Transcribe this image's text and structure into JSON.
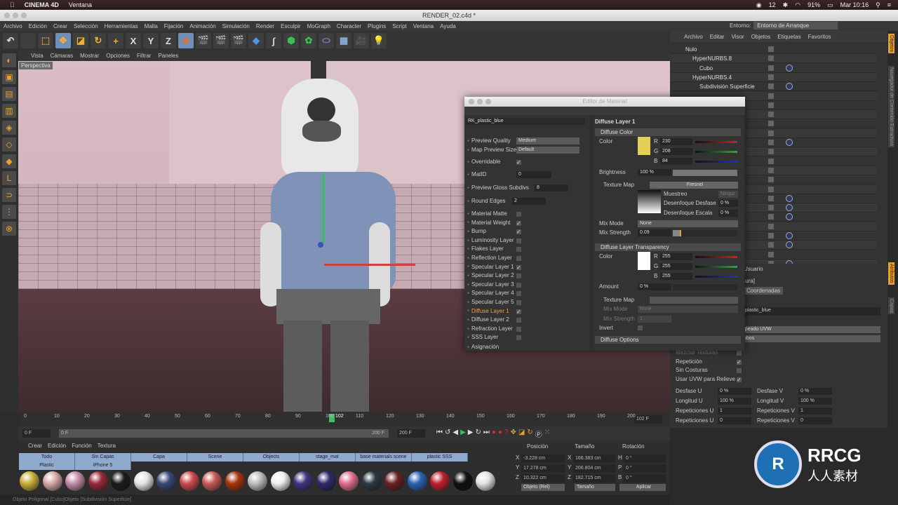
{
  "macbar": {
    "app": "CINEMA 4D",
    "menu": "Ventana",
    "status": [
      "12",
      "91%"
    ],
    "clock": "Mar 10:16"
  },
  "window": {
    "title": "RENDER_02.c4d *"
  },
  "mainmenu": [
    "Archivo",
    "Edición",
    "Crear",
    "Selección",
    "Herramientas",
    "Malla",
    "Fijación",
    "Animación",
    "Simulación",
    "Render",
    "Esculpir",
    "MoGraph",
    "Character",
    "Plugins",
    "Script",
    "Ventana",
    "Ayuda"
  ],
  "env": {
    "label": "Entorno:",
    "value": "Entorno de Arranque"
  },
  "toolbar": {
    "axes": [
      "X",
      "Y",
      "Z"
    ]
  },
  "viewport": {
    "menu": [
      "Vista",
      "Cámaras",
      "Mostrar",
      "Opciones",
      "Filtrar",
      "Paneles"
    ],
    "label": "Perspectiva"
  },
  "timeline": {
    "ticks": [
      "0",
      "10",
      "20",
      "30",
      "40",
      "50",
      "60",
      "70",
      "80",
      "90",
      "100",
      "110",
      "120",
      "130",
      "140",
      "150",
      "160",
      "170",
      "180",
      "190",
      "200"
    ],
    "current": "102",
    "current_field": "102 F",
    "start": "0 F",
    "range_start": "0 F",
    "range_end": "200 F",
    "end": "200 F"
  },
  "materials": {
    "menu": [
      "Crear",
      "Edición",
      "Función",
      "Textura"
    ],
    "layers": [
      "Todo",
      "Sin Capas",
      "Capa",
      "Scene",
      "Objects",
      "stage_mat",
      "base materials scene",
      "plastic SSS",
      "Plastic",
      "iPhone 5"
    ],
    "swatches": [
      "#c9b03a",
      "#d4aaa4",
      "#c48ca8",
      "#9a2a3a",
      "#1c1c20",
      "#e6e6e6",
      "#3a4a78",
      "#d04a50",
      "#c85a58",
      "#a8340e",
      "#bdbdbd",
      "#efefef",
      "#3e3680",
      "#2e2a6a",
      "#e0708e",
      "#2a3a44",
      "#6a2224",
      "#2a64b4",
      "#c0202c",
      "#101010",
      "#e4e4e4"
    ]
  },
  "coords": {
    "headers": [
      "Posición",
      "Tamaño",
      "Rotación"
    ],
    "rows": [
      {
        "axis": "X",
        "pos": "-3.228 cm",
        "size": "166.383 cm",
        "rl": "H",
        "rot": "0 °"
      },
      {
        "axis": "Y",
        "pos": "17.278 cm",
        "size": "206.804 cm",
        "rl": "P",
        "rot": "0 °"
      },
      {
        "axis": "Z",
        "pos": "10.322 cm",
        "size": "182.715 cm",
        "rl": "B",
        "rot": "0 °"
      }
    ],
    "mode": "Objeto (Rel)",
    "size_mode": "Tamaño",
    "apply": "Aplicar"
  },
  "status": "Objeto Poligonal [Cubo]Objeto [Subdivisión Superficie]",
  "objmgr": {
    "menu": [
      "Archivo",
      "Editar",
      "Visor",
      "Objetos",
      "Etiquetas",
      "Favoritos"
    ],
    "objects": [
      {
        "name": "Nulo",
        "indent": 0
      },
      {
        "name": "HyperNURBS.8",
        "indent": 1
      },
      {
        "name": "Cubo",
        "indent": 2
      },
      {
        "name": "HyperNURBS.4",
        "indent": 1
      },
      {
        "name": "Subdivisión Superficie",
        "indent": 2
      }
    ]
  },
  "sidetabs": [
    "Objetos",
    "Navegador de Contenido",
    "Estructura",
    "Atributos",
    "Capas"
  ],
  "attr": {
    "mode": "Usuario",
    "tab_partial": "tura]",
    "coord_tab": "Coordenadas",
    "material": "_plastic_blue",
    "projection": "apeado UVW",
    "side": "mbos",
    "checks": [
      {
        "label": "Mezclar Texturas",
        "checked": false
      },
      {
        "label": "Repetición",
        "checked": true
      },
      {
        "label": "Sin Costuras",
        "checked": false
      },
      {
        "label": "Usar UVW para Relieve",
        "checked": true
      }
    ],
    "fields": [
      {
        "l1": "Desfase U",
        "v1": "0 %",
        "l2": "Desfase V",
        "v2": "0 %"
      },
      {
        "l1": "Longitud U",
        "v1": "100 %",
        "l2": "Longitud V",
        "v2": "100 %"
      },
      {
        "l1": "Repeticiones U",
        "v1": "1",
        "l2": "Repeticiones V",
        "v2": "1"
      },
      {
        "l1": "Repeticiones U",
        "v1": "0",
        "l2": "Repeticiones V",
        "v2": "0"
      }
    ]
  },
  "mated": {
    "title": "Editor de Material",
    "name": "RK_plastic_blue",
    "preview_quality": {
      "label": "Preview Quality",
      "value": "Medium"
    },
    "map_preview": {
      "label": "Map Preview Size",
      "value": "Default"
    },
    "overridable": "Overridable",
    "matid": {
      "label": "MatID",
      "value": "0"
    },
    "gloss": {
      "label": "Preview Gloss Subdivs",
      "value": "8"
    },
    "round": {
      "label": "Round Edges",
      "value": "2"
    },
    "layers": [
      {
        "label": "Material Matte",
        "checked": false
      },
      {
        "label": "Material Weight",
        "checked": true
      },
      {
        "label": "Bump",
        "checked": true
      },
      {
        "label": "Luminosity Layer",
        "checked": false
      },
      {
        "label": "Flakes Layer",
        "checked": false
      },
      {
        "label": "Reflection Layer",
        "checked": false
      },
      {
        "label": "Specular Layer 1",
        "checked": true
      },
      {
        "label": "Specular Layer 2",
        "checked": false
      },
      {
        "label": "Specular Layer 3",
        "checked": false
      },
      {
        "label": "Specular Layer 4",
        "checked": false
      },
      {
        "label": "Specular Layer 5",
        "checked": false
      },
      {
        "label": "Diffuse Layer 1",
        "checked": true,
        "active": true
      },
      {
        "label": "Diffuse Layer 2",
        "checked": false
      },
      {
        "label": "Refraction Layer",
        "checked": false
      },
      {
        "label": "SSS Layer",
        "checked": false
      }
    ],
    "assign": "Asignación",
    "right": {
      "title": "Diffuse Layer 1",
      "diffuse_color": "Diffuse Color",
      "color_label": "Color",
      "rgb": {
        "r": "230",
        "g": "208",
        "b": "84",
        "hex": "#e6d054"
      },
      "brightness": {
        "label": "Brightness",
        "value": "100 %"
      },
      "texmap": {
        "label": "Texture Map",
        "value": "Fresnel"
      },
      "muestreo": {
        "label": "Muestreo",
        "value": "Ningur"
      },
      "desf": {
        "label": "Desenfoque Desfase",
        "value": "0 %"
      },
      "esc": {
        "label": "Desenfoque Escala",
        "value": "0 %"
      },
      "mixmode": {
        "label": "Mix Mode",
        "value": "None"
      },
      "mixstr": {
        "label": "Mix Strength",
        "value": "0.09",
        "fraction": 0.09
      },
      "transp": "Diffuse Layer Transparency",
      "trgb": {
        "r": "255",
        "g": "255",
        "b": "255",
        "hex": "#ffffff"
      },
      "amount": {
        "label": "Amount",
        "value": "0 %"
      },
      "texmap2": "Texture Map",
      "mixmode2": {
        "label": "Mix Mode",
        "value": "None"
      },
      "mixstr2": {
        "label": "Mix Strength",
        "value": "1"
      },
      "invert": "Invert",
      "options": "Diffuse Options"
    }
  },
  "logo": {
    "text": "RRCG",
    "sub": "人人素材"
  }
}
